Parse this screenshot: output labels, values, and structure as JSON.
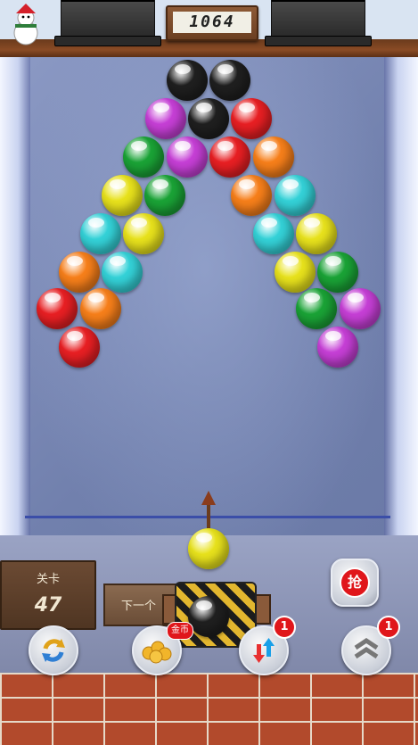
{
  "score": "1064",
  "colors": {
    "black": "#1f1f1f",
    "purple": "#c63fd6",
    "red": "#e81f23",
    "green": "#1aa336",
    "orange": "#f77f1a",
    "yellow": "#e8e21c",
    "cyan": "#34d2d8"
  },
  "bubbles": [
    {
      "color": "black"
    },
    {
      "color": "black"
    },
    {
      "color": "purple"
    },
    {
      "color": "black"
    },
    {
      "color": "red"
    },
    {
      "color": "green"
    },
    {
      "color": "purple"
    },
    {
      "color": "red"
    },
    {
      "color": "orange"
    },
    {
      "color": "yellow"
    },
    {
      "color": "green"
    },
    {
      "color": "orange"
    },
    {
      "color": "cyan"
    },
    {
      "color": "cyan"
    },
    {
      "color": "yellow"
    },
    {
      "color": "cyan"
    },
    {
      "color": "yellow"
    },
    {
      "color": "orange"
    },
    {
      "color": "cyan"
    },
    {
      "color": "yellow"
    },
    {
      "color": "green"
    },
    {
      "color": "red"
    },
    {
      "color": "orange"
    },
    {
      "color": "green"
    },
    {
      "color": "purple"
    },
    {
      "color": "red"
    },
    {
      "color": "purple"
    }
  ],
  "level": {
    "label": "关卡",
    "value": "47"
  },
  "next_label": "下一个",
  "current_ball": "yellow",
  "next_ball": "black",
  "tools": {
    "refresh": {
      "icon": "refresh-icon"
    },
    "coins": {
      "icon": "coins-icon",
      "tag": "金币"
    },
    "swap": {
      "icon": "swap-arrows-icon",
      "count": "1"
    },
    "fireball": {
      "icon": "chevrons-icon",
      "count": "1"
    },
    "grab": {
      "icon": "grab-icon",
      "label": "抢"
    }
  }
}
